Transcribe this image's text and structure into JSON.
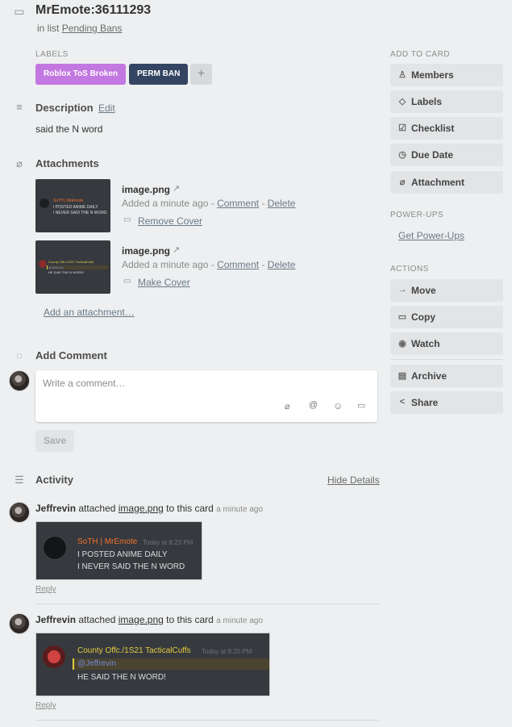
{
  "card": {
    "title": "MrEmote:36111293",
    "in_list_prefix": "in list",
    "list_name": "Pending Bans"
  },
  "labels": {
    "caption": "LABELS",
    "items": [
      {
        "text": "Roblox ToS Broken",
        "color": "#c377e0"
      },
      {
        "text": "PERM BAN",
        "color": "#344563"
      }
    ],
    "add": "+"
  },
  "description": {
    "heading": "Description",
    "edit": "Edit",
    "text": "said the N word"
  },
  "attachments": {
    "heading": "Attachments",
    "items": [
      {
        "name": "image.png",
        "added": "Added a minute ago -",
        "comment": "Comment",
        "dash": "-",
        "delete": "Delete",
        "cover_action": "Remove Cover",
        "thumb": {
          "author": "SoTH | MrEmote",
          "ts": "Today at 8:23 PM",
          "lines": [
            "I POSTED ANIME DAILY",
            "I NEVER SAID THE N WORD"
          ]
        }
      },
      {
        "name": "image.png",
        "added": "Added a minute ago -",
        "comment": "Comment",
        "dash": "-",
        "delete": "Delete",
        "cover_action": "Make Cover",
        "thumb": {
          "author": "County Offc./1S21 TacticalCuffs",
          "ts": "Today at 8:20 PM",
          "lines": [
            "@Jeffrevin",
            "HE SAID THE N WORD!"
          ]
        }
      }
    ],
    "add_link": "Add an attachment…"
  },
  "add_comment": {
    "heading": "Add Comment",
    "placeholder": "Write a comment…",
    "save": "Save",
    "tool_icons": [
      "paperclip-icon",
      "at-icon",
      "emoji-icon",
      "card-icon"
    ]
  },
  "activity": {
    "heading": "Activity",
    "hide_details": "Hide Details",
    "entries": [
      {
        "user": "Jeffrevin",
        "verb": "attached",
        "file": "image.png",
        "suffix": "to this card",
        "time": "a minute ago",
        "reply": "Reply",
        "preview": {
          "author": "SoTH | MrEmote",
          "ts": "Today at 8:23 PM",
          "lines": [
            "I POSTED ANIME DAILY",
            "I NEVER SAID THE N WORD"
          ]
        }
      },
      {
        "user": "Jeffrevin",
        "verb": "attached",
        "file": "image.png",
        "suffix": "to this card",
        "time": "a minute ago",
        "reply": "Reply",
        "preview": {
          "author": "County Offc./1S21 TacticalCuffs",
          "ts": "Today at 8:20 PM",
          "mention": "@Jeffrevin",
          "line": "HE SAID THE N WORD!"
        }
      }
    ]
  },
  "sidebar": {
    "add_to_card": {
      "caption": "ADD TO CARD",
      "buttons": [
        {
          "label": "Members",
          "icon": "person-icon"
        },
        {
          "label": "Labels",
          "icon": "tag-icon"
        },
        {
          "label": "Checklist",
          "icon": "checklist-icon"
        },
        {
          "label": "Due Date",
          "icon": "clock-icon"
        },
        {
          "label": "Attachment",
          "icon": "paperclip-icon"
        }
      ]
    },
    "power_ups": {
      "caption": "POWER-UPS",
      "link": "Get Power-Ups"
    },
    "actions": {
      "caption": "ACTIONS",
      "buttons": [
        {
          "label": "Move",
          "icon": "arrow-right-icon"
        },
        {
          "label": "Copy",
          "icon": "copy-icon"
        },
        {
          "label": "Watch",
          "icon": "eye-icon"
        },
        {
          "label": "Archive",
          "icon": "archive-icon"
        },
        {
          "label": "Share",
          "icon": "share-icon"
        }
      ]
    }
  }
}
